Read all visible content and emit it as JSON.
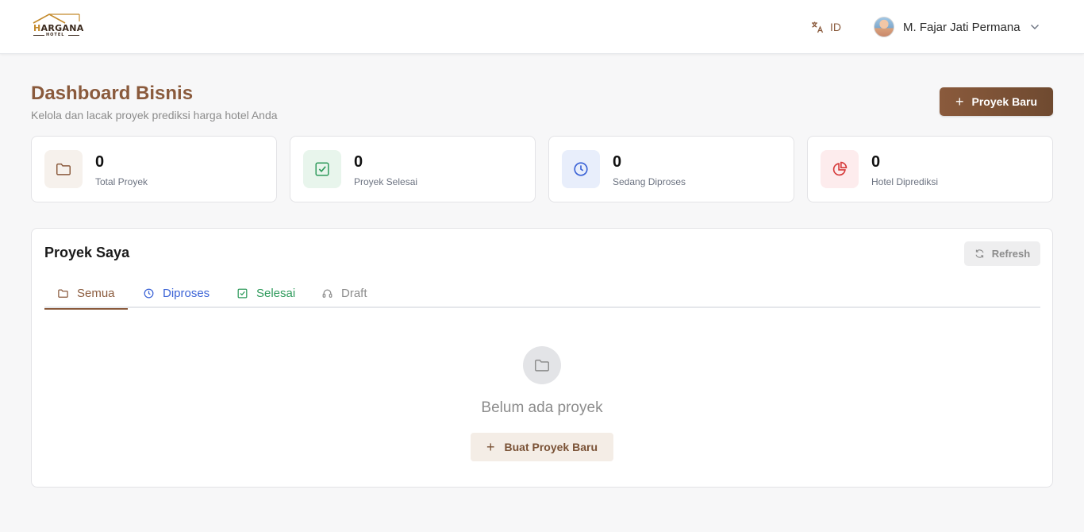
{
  "header": {
    "logo": {
      "brand": "HARGANA",
      "brand_first": "H",
      "brand_rest": "ARGANA",
      "sub": "HOTEL"
    },
    "language": {
      "code": "ID",
      "icon": "translate-icon"
    },
    "user": {
      "name": "M. Fajar Jati Permana",
      "icon": "chevron-down-icon"
    }
  },
  "page": {
    "title": "Dashboard Bisnis",
    "subtitle": "Kelola dan lacak proyek prediksi harga hotel Anda",
    "new_project_label": "Proyek Baru"
  },
  "stats": [
    {
      "value": "0",
      "label": "Total Proyek",
      "icon": "folder-icon",
      "color": "#8a5a3c",
      "bg": "#f6f1ec"
    },
    {
      "value": "0",
      "label": "Proyek Selesai",
      "icon": "check-square-icon",
      "color": "#2e9a5b",
      "bg": "#e8f5ec"
    },
    {
      "value": "0",
      "label": "Sedang Diproses",
      "icon": "clock-icon",
      "color": "#3b63d6",
      "bg": "#e8eefb"
    },
    {
      "value": "0",
      "label": "Hotel Diprediksi",
      "icon": "pie-chart-icon",
      "color": "#d63b3b",
      "bg": "#fdeced"
    }
  ],
  "projects": {
    "title": "Proyek Saya",
    "refresh_label": "Refresh",
    "tabs": [
      {
        "label": "Semua",
        "icon": "folder-icon",
        "color": "#8a5a3c",
        "active": true
      },
      {
        "label": "Diproses",
        "icon": "clock-icon",
        "color": "#3b63d6",
        "active": false
      },
      {
        "label": "Selesai",
        "icon": "check-square-icon",
        "color": "#2e9a5b",
        "active": false
      },
      {
        "label": "Draft",
        "icon": "headset-icon",
        "color": "#8c8c8c",
        "active": false
      }
    ],
    "empty_text": "Belum ada proyek",
    "create_label": "Buat Proyek Baru"
  }
}
